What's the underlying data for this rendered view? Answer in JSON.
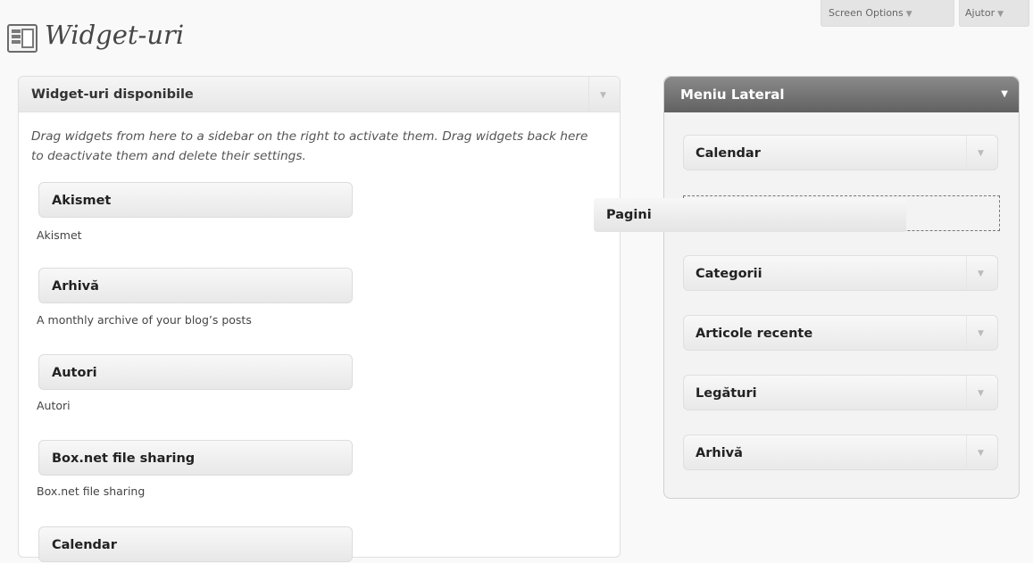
{
  "header": {
    "screen_options": "Screen Options",
    "help": "Ajutor",
    "title": "Widget-uri",
    "icon": "widgets-icon"
  },
  "available": {
    "title": "Widget-uri disponibile",
    "description": "Drag widgets from here to a sidebar on the right to activate them. Drag widgets back here to deactivate them and delete their settings.",
    "widgets": [
      {
        "title": "Akismet",
        "desc": "Akismet"
      },
      {
        "title": "Arhivă",
        "desc": "A monthly archive of your blog’s posts"
      },
      {
        "title": "Autori",
        "desc": "Autori"
      },
      {
        "title": "Box.net file sharing",
        "desc": "Box.net file sharing"
      },
      {
        "title": "Calendar",
        "desc": ""
      }
    ]
  },
  "sidebar": {
    "title": "Meniu Lateral",
    "widgets": [
      {
        "title": "Calendar"
      },
      {
        "title": "Categorii"
      },
      {
        "title": "Articole recente"
      },
      {
        "title": "Legături"
      },
      {
        "title": "Arhivă"
      }
    ]
  },
  "dragging": {
    "title": "Pagini"
  },
  "icons": {
    "collapse": "triangle-down-icon"
  }
}
